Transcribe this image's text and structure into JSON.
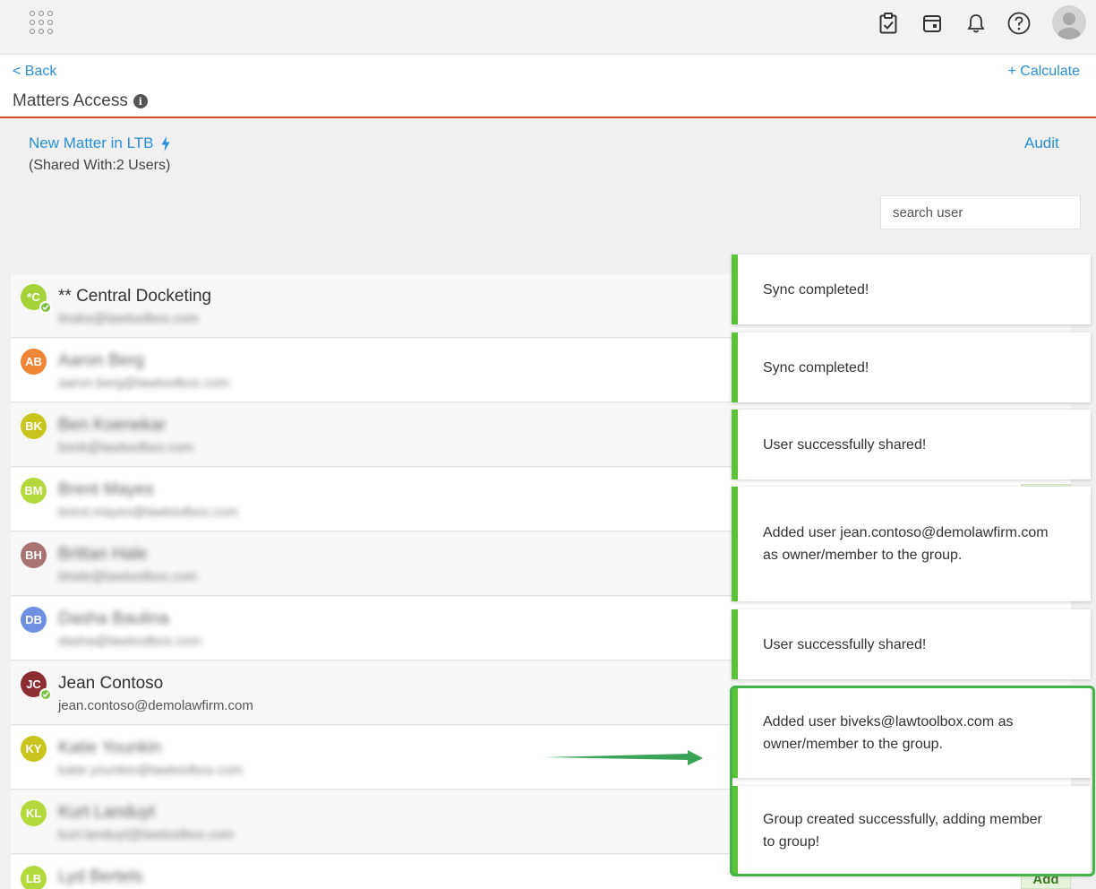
{
  "topbar": {
    "icons": [
      "apps-grid-icon",
      "clipboard-check-icon",
      "calendar-icon",
      "bell-icon",
      "help-icon",
      "user-avatar-icon"
    ]
  },
  "header": {
    "back_label": "< Back",
    "calculate_label": "+ Calculate",
    "title": "Matters Access"
  },
  "matter": {
    "name": "New Matter in LTB",
    "shared_with": "(Shared With:2 Users)",
    "audit_label": "Audit"
  },
  "search": {
    "placeholder": "search user"
  },
  "users": [
    {
      "initials": "*C",
      "name": "** Central Docketing",
      "email": "linaks@lawtoolbox.com",
      "color": "#a6d23a",
      "checked": true,
      "blurred_email": true
    },
    {
      "initials": "AB",
      "name": "Aaron Berg",
      "email": "aaron.berg@lawtoolbox.com",
      "color": "#ef8536",
      "blurred": true
    },
    {
      "initials": "BK",
      "name": "Ben Koenekar",
      "email": "benk@lawtoolbox.com",
      "color": "#c8c61e",
      "blurred": true
    },
    {
      "initials": "BM",
      "name": "Brent Mayes",
      "email": "brent.mayes@lawtoolbox.com",
      "color": "#b4d93c",
      "blurred": true
    },
    {
      "initials": "BH",
      "name": "Brittan Hale",
      "email": "bhale@lawtoolbox.com",
      "color": "#a97373",
      "blurred": true
    },
    {
      "initials": "DB",
      "name": "Dasha Baulina",
      "email": "dasha@lawtoolbox.com",
      "color": "#6f8fe0",
      "blurred": true
    },
    {
      "initials": "JC",
      "name": "Jean Contoso",
      "email": "jean.contoso@demolawfirm.com",
      "color": "#8b2d32",
      "checked": true
    },
    {
      "initials": "KY",
      "name": "Katie Younkin",
      "email": "katie.younkin@lawtoolbox.com",
      "color": "#c8c61e",
      "blurred": true
    },
    {
      "initials": "KL",
      "name": "Kurt Landuyt",
      "email": "kurt.landuyt@lawtoolbox.com",
      "color": "#b4d93c",
      "blurred": true
    },
    {
      "initials": "LB",
      "name": "Lyd Bertels",
      "email": "",
      "color": "#b4d93c",
      "blurred": true
    }
  ],
  "row_action_label": "Add",
  "toasts": [
    "Sync completed!",
    "Sync completed!",
    "User successfully shared!",
    "Added user jean.contoso@demolawfirm.com as owner/member to the group.",
    "User successfully shared!",
    "Added user biveks@lawtoolbox.com as owner/member to the group.",
    "Group created successfully, adding member to group!"
  ],
  "colors": {
    "link": "#2b8fd4",
    "accent_line": "#d9482b",
    "toast_border": "#5ac236",
    "highlight": "#45b34a"
  }
}
